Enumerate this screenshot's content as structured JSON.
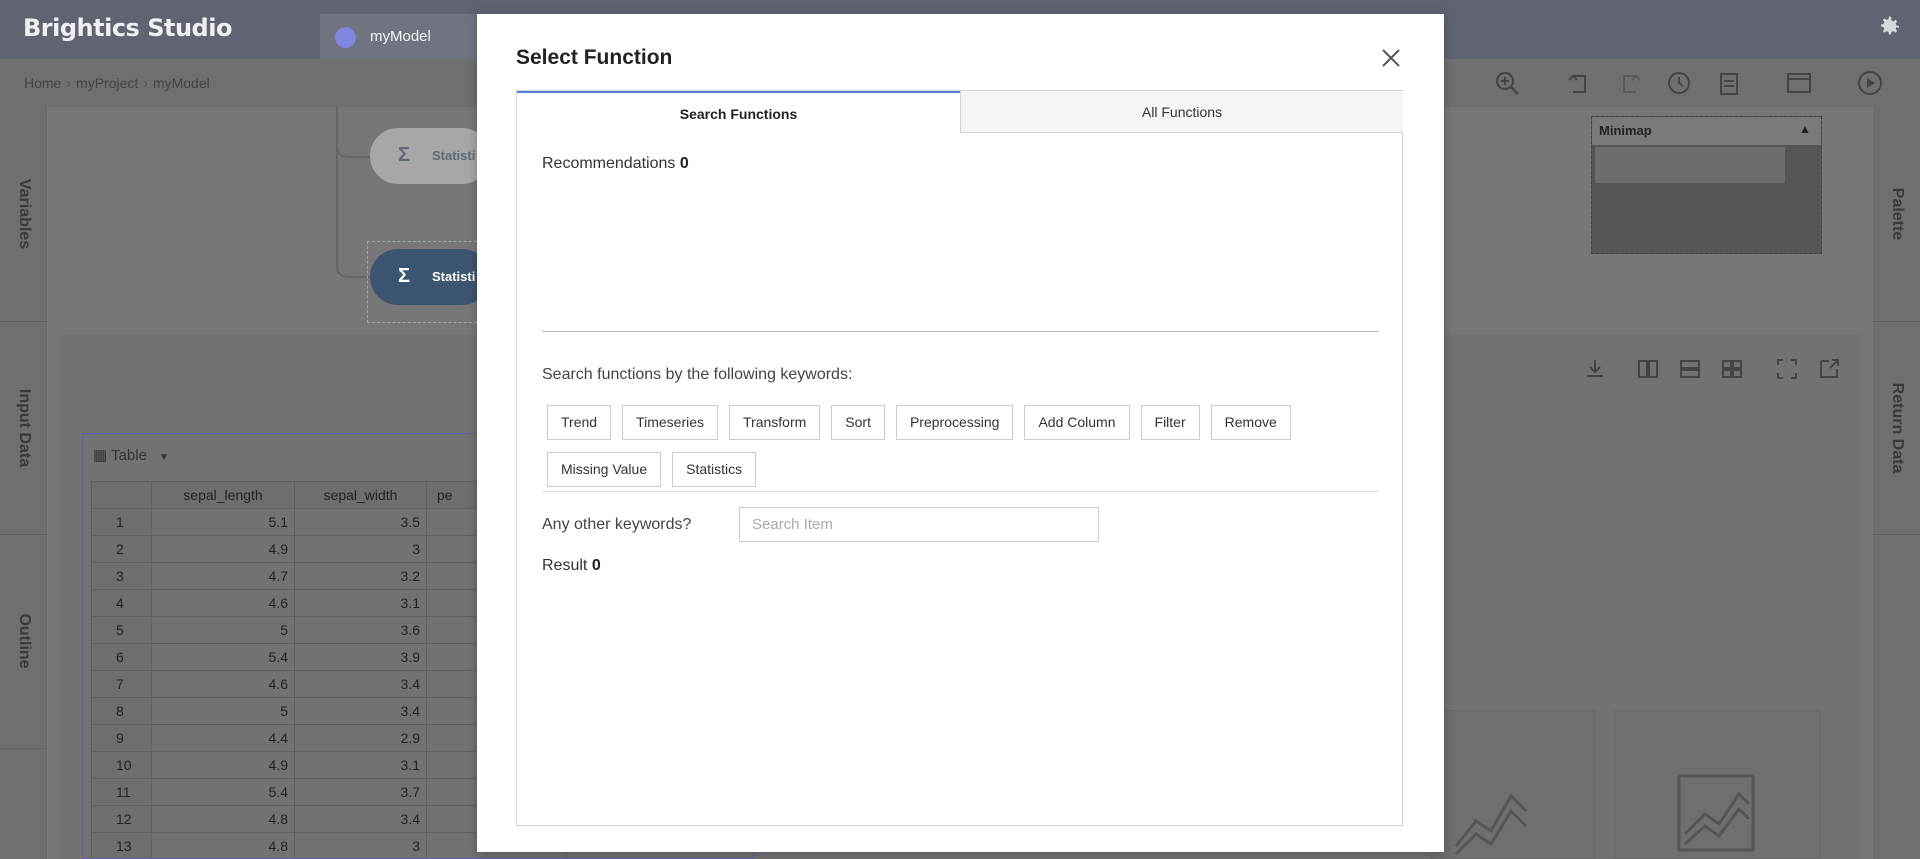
{
  "app": {
    "title": "Brightics Studio",
    "tab_label": "myModel"
  },
  "breadcrumb": {
    "home": "Home",
    "project": "myProject",
    "model": "myModel"
  },
  "left_sidebar": {
    "items": [
      "Variables",
      "Input Data",
      "Outline"
    ]
  },
  "right_sidebar": {
    "items": [
      "Palette",
      "Return Data"
    ]
  },
  "canvas": {
    "nodes": [
      {
        "label": "Statisti"
      },
      {
        "label": "Statisti"
      }
    ]
  },
  "minimap": {
    "title": "Minimap"
  },
  "data_table": {
    "view_label": "Table",
    "columns": [
      "sepal_length",
      "sepal_width",
      "pe"
    ],
    "rows": [
      [
        "1",
        "5.1",
        "3.5"
      ],
      [
        "2",
        "4.9",
        "3"
      ],
      [
        "3",
        "4.7",
        "3.2"
      ],
      [
        "4",
        "4.6",
        "3.1"
      ],
      [
        "5",
        "5",
        "3.6"
      ],
      [
        "6",
        "5.4",
        "3.9"
      ],
      [
        "7",
        "4.6",
        "3.4"
      ],
      [
        "8",
        "5",
        "3.4"
      ],
      [
        "9",
        "4.4",
        "2.9"
      ],
      [
        "10",
        "4.9",
        "3.1"
      ],
      [
        "11",
        "5.4",
        "3.7"
      ],
      [
        "12",
        "4.8",
        "3.4"
      ],
      [
        "13",
        "4.8",
        "3"
      ]
    ]
  },
  "modal": {
    "title": "Select Function",
    "tabs": [
      "Search Functions",
      "All Functions"
    ],
    "recommendations_label": "Recommendations",
    "recommendations_count": "0",
    "keywords_title": "Search functions by the following keywords:",
    "keywords": [
      "Trend",
      "Timeseries",
      "Transform",
      "Sort",
      "Preprocessing",
      "Add Column",
      "Filter",
      "Remove",
      "Missing Value",
      "Statistics"
    ],
    "other_label": "Any other keywords?",
    "search_placeholder": "Search Item",
    "search_value": "",
    "result_label": "Result",
    "result_count": "0"
  },
  "colors": {
    "topbar": "#5f6470",
    "accent": "#5a7fd8",
    "node_selected": "#3c5570"
  }
}
